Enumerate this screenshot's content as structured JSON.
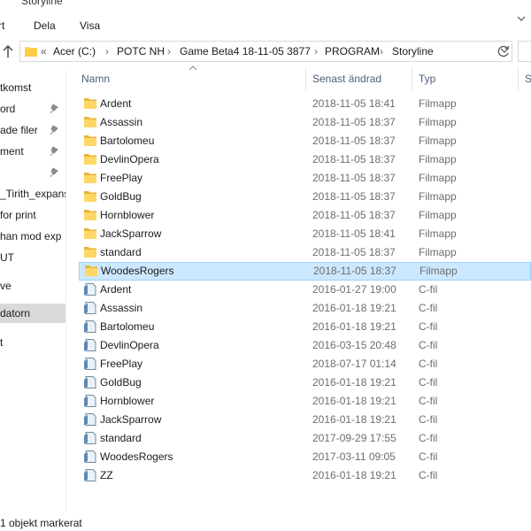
{
  "window": {
    "title": "Storyline"
  },
  "ribbon": {
    "tabs": [
      "rt",
      "Dela",
      "Visa"
    ]
  },
  "address": {
    "overflow": "«",
    "crumbs": [
      "Acer (C:)",
      "POTC NH",
      "Game Beta4 18-11-05 3877",
      "PROGRAM",
      "Storyline"
    ],
    "separator": "›"
  },
  "nav": {
    "items": [
      {
        "label": "tkomst",
        "pinned": false
      },
      {
        "label": "ord",
        "pinned": true
      },
      {
        "label": "ade filer",
        "pinned": true
      },
      {
        "label": "ment",
        "pinned": true
      },
      {
        "label": "",
        "pinned": true
      },
      {
        "label": "_Tirith_expans",
        "pinned": false
      },
      {
        "label": "for print",
        "pinned": false
      },
      {
        "label": "han mod exp",
        "pinned": false
      },
      {
        "label": "UT",
        "pinned": false
      },
      {
        "label": "ve",
        "pinned": false
      },
      {
        "label": " datorn",
        "pinned": false,
        "selected": true
      },
      {
        "label": "t",
        "pinned": false
      }
    ]
  },
  "columns": {
    "name": "Namn",
    "modified": "Senast ändrad",
    "type": "Typ",
    "size": "S"
  },
  "files": [
    {
      "name": "Ardent",
      "modified": "2018-11-05 18:41",
      "type": "Filmapp",
      "icon": "folder-icon"
    },
    {
      "name": "Assassin",
      "modified": "2018-11-05 18:37",
      "type": "Filmapp",
      "icon": "folder-icon"
    },
    {
      "name": "Bartolomeu",
      "modified": "2018-11-05 18:37",
      "type": "Filmapp",
      "icon": "folder-icon"
    },
    {
      "name": "DevlinOpera",
      "modified": "2018-11-05 18:37",
      "type": "Filmapp",
      "icon": "folder-icon"
    },
    {
      "name": "FreePlay",
      "modified": "2018-11-05 18:37",
      "type": "Filmapp",
      "icon": "folder-icon"
    },
    {
      "name": "GoldBug",
      "modified": "2018-11-05 18:37",
      "type": "Filmapp",
      "icon": "folder-icon"
    },
    {
      "name": "Hornblower",
      "modified": "2018-11-05 18:37",
      "type": "Filmapp",
      "icon": "folder-icon"
    },
    {
      "name": "JackSparrow",
      "modified": "2018-11-05 18:41",
      "type": "Filmapp",
      "icon": "folder-icon"
    },
    {
      "name": "standard",
      "modified": "2018-11-05 18:37",
      "type": "Filmapp",
      "icon": "folder-icon"
    },
    {
      "name": "WoodesRogers",
      "modified": "2018-11-05 18:37",
      "type": "Filmapp",
      "icon": "folder-icon",
      "selected": true
    },
    {
      "name": "Ardent",
      "modified": "2016-01-27 19:00",
      "type": "C-fil",
      "icon": "file-icon"
    },
    {
      "name": "Assassin",
      "modified": "2016-01-18 19:21",
      "type": "C-fil",
      "icon": "file-icon"
    },
    {
      "name": "Bartolomeu",
      "modified": "2016-01-18 19:21",
      "type": "C-fil",
      "icon": "file-icon"
    },
    {
      "name": "DevlinOpera",
      "modified": "2016-03-15 20:48",
      "type": "C-fil",
      "icon": "file-icon"
    },
    {
      "name": "FreePlay",
      "modified": "2018-07-17 01:14",
      "type": "C-fil",
      "icon": "file-icon"
    },
    {
      "name": "GoldBug",
      "modified": "2016-01-18 19:21",
      "type": "C-fil",
      "icon": "file-icon"
    },
    {
      "name": "Hornblower",
      "modified": "2016-01-18 19:21",
      "type": "C-fil",
      "icon": "file-icon"
    },
    {
      "name": "JackSparrow",
      "modified": "2016-01-18 19:21",
      "type": "C-fil",
      "icon": "file-icon"
    },
    {
      "name": "standard",
      "modified": "2017-09-29 17:55",
      "type": "C-fil",
      "icon": "file-icon"
    },
    {
      "name": "WoodesRogers",
      "modified": "2017-03-11 09:05",
      "type": "C-fil",
      "icon": "file-icon"
    },
    {
      "name": "ZZ",
      "modified": "2016-01-18 19:21",
      "type": "C-fil",
      "icon": "file-icon"
    }
  ],
  "status": {
    "text": "1 objekt markerat"
  },
  "colors": {
    "folder": "#ffd766",
    "selection_bg": "#cce8ff",
    "selection_border": "#99d1ff",
    "header_text": "#4c607a"
  }
}
